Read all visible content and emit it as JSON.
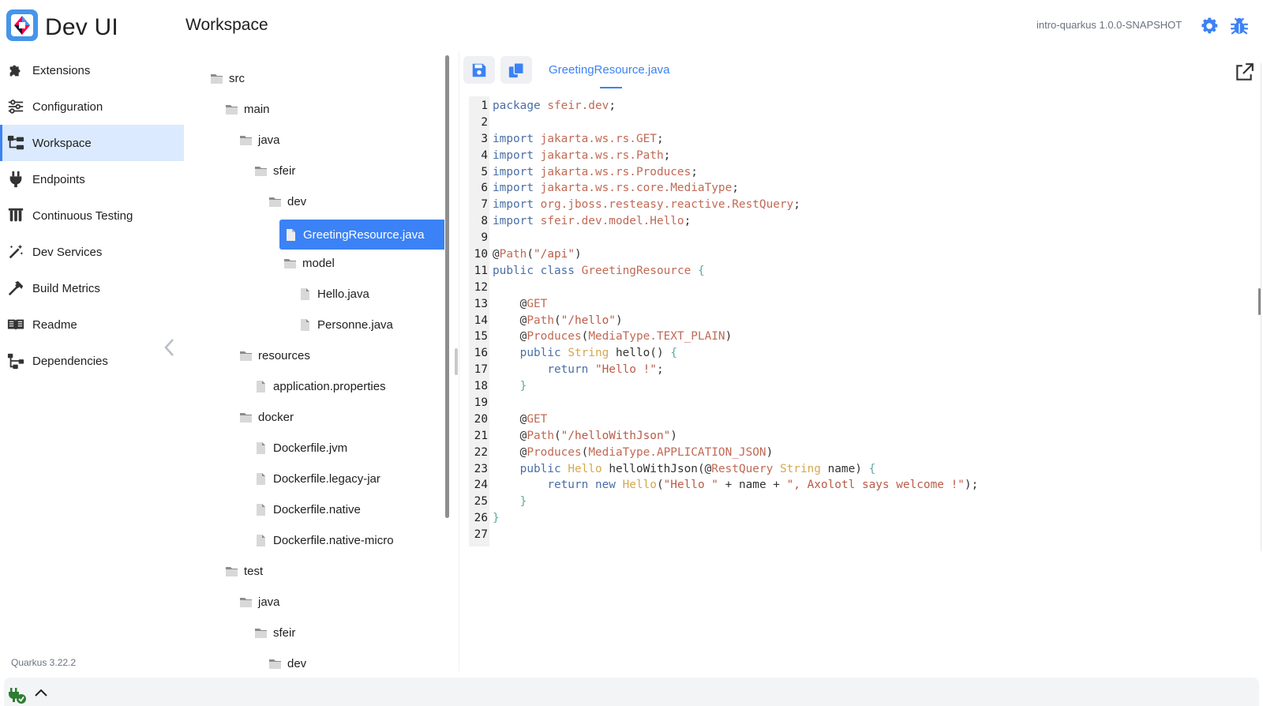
{
  "app": {
    "title": "Dev UI"
  },
  "header": {
    "page_title": "Workspace",
    "app_version": "intro-quarkus 1.0.0-SNAPSHOT",
    "accent": "#3b82f6"
  },
  "sidebar": {
    "items": [
      {
        "label": "Extensions",
        "icon": "puzzle-icon"
      },
      {
        "label": "Configuration",
        "icon": "sliders-icon"
      },
      {
        "label": "Workspace",
        "icon": "folder-tree-icon",
        "active": true
      },
      {
        "label": "Endpoints",
        "icon": "plug-icon"
      },
      {
        "label": "Continuous Testing",
        "icon": "flask-icon"
      },
      {
        "label": "Dev Services",
        "icon": "magic-wand-icon"
      },
      {
        "label": "Build Metrics",
        "icon": "hammer-icon"
      },
      {
        "label": "Readme",
        "icon": "book-icon"
      },
      {
        "label": "Dependencies",
        "icon": "dependency-graph-icon"
      }
    ],
    "quarkus_version": "Quarkus 3.22.2"
  },
  "tree": {
    "nodes": [
      {
        "label": "src",
        "type": "folder"
      },
      {
        "label": "main",
        "type": "folder"
      },
      {
        "label": "java",
        "type": "folder"
      },
      {
        "label": "sfeir",
        "type": "folder"
      },
      {
        "label": "dev",
        "type": "folder"
      },
      {
        "label": "GreetingResource.java",
        "type": "file",
        "selected": true
      },
      {
        "label": "model",
        "type": "folder"
      },
      {
        "label": "Hello.java",
        "type": "file"
      },
      {
        "label": "Personne.java",
        "type": "file"
      },
      {
        "label": "resources",
        "type": "folder"
      },
      {
        "label": "application.properties",
        "type": "file"
      },
      {
        "label": "docker",
        "type": "folder"
      },
      {
        "label": "Dockerfile.jvm",
        "type": "file"
      },
      {
        "label": "Dockerfile.legacy-jar",
        "type": "file"
      },
      {
        "label": "Dockerfile.native",
        "type": "file"
      },
      {
        "label": "Dockerfile.native-micro",
        "type": "file"
      },
      {
        "label": "test",
        "type": "folder"
      },
      {
        "label": "java",
        "type": "folder"
      },
      {
        "label": "sfeir",
        "type": "folder"
      },
      {
        "label": "dev",
        "type": "folder"
      }
    ]
  },
  "editor": {
    "tab_label": "GreetingResource.java",
    "save_icon": "save-icon",
    "copy_icon": "copy-icon",
    "lines": [
      "package sfeir.dev;",
      "",
      "import jakarta.ws.rs.GET;",
      "import jakarta.ws.rs.Path;",
      "import jakarta.ws.rs.Produces;",
      "import jakarta.ws.rs.core.MediaType;",
      "import org.jboss.resteasy.reactive.RestQuery;",
      "import sfeir.dev.model.Hello;",
      "",
      "@Path(\"/api\")",
      "public class GreetingResource {",
      "",
      "    @GET",
      "    @Path(\"/hello\")",
      "    @Produces(MediaType.TEXT_PLAIN)",
      "    public String hello() {",
      "        return \"Hello !\";",
      "    }",
      "",
      "    @GET",
      "    @Path(\"/helloWithJson\")",
      "    @Produces(MediaType.APPLICATION_JSON)",
      "    public Hello helloWithJson(@RestQuery String name) {",
      "        return new Hello(\"Hello \" + name + \", Axolotl says welcome !\");",
      "    }",
      "}",
      ""
    ]
  }
}
